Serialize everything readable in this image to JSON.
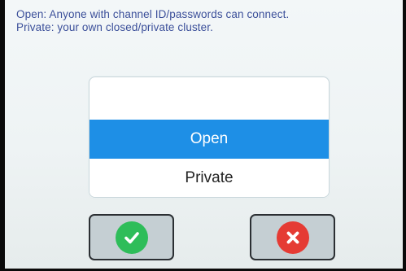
{
  "help_text": {
    "line1": "Open: Anyone with channel ID/passwords can connect.",
    "line2": "Private: your own closed/private cluster."
  },
  "picker": {
    "options": [
      {
        "label": "Open",
        "selected": true
      },
      {
        "label": "Private",
        "selected": false
      }
    ],
    "selected_value": "Open"
  },
  "buttons": {
    "confirm_icon": "check-icon",
    "cancel_icon": "close-icon"
  },
  "colors": {
    "help_text": "#3b4f9a",
    "selection": "#1e8fe6",
    "confirm": "#2ebd59",
    "cancel": "#e53b34",
    "button_bg": "#c5cfd3"
  }
}
